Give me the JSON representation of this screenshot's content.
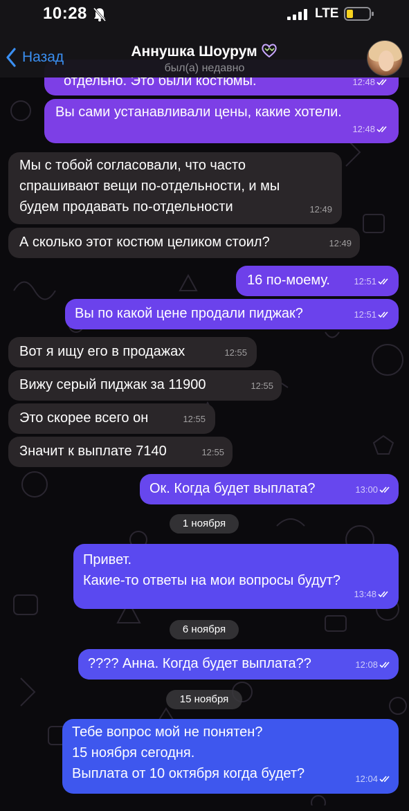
{
  "status_bar": {
    "time": "10:28",
    "network": "LTE"
  },
  "header": {
    "back_label": "Назад",
    "title": "Аннушка Шоурум",
    "status": "был(а) недавно"
  },
  "messages": [
    {
      "id": "m0",
      "direction": "out",
      "text": "отдельно. Это были костюмы.",
      "time": "12:48"
    },
    {
      "id": "m1",
      "direction": "out",
      "text": "Вы сами устанавливали цены, какие хотели.",
      "time": "12:48"
    },
    {
      "id": "m2",
      "direction": "in",
      "text": "Мы с тобой согласовали, что часто\nспрашивают вещи по-отдельности, и мы\nбудем продавать по-отдельности",
      "time": "12:49"
    },
    {
      "id": "m3",
      "direction": "in",
      "text": "А сколько этот костюм целиком стоил?",
      "time": "12:49"
    },
    {
      "id": "m4",
      "direction": "out",
      "text": "16 по-моему.",
      "time": "12:51"
    },
    {
      "id": "m5",
      "direction": "out",
      "text": "Вы по какой цене продали пиджак?",
      "time": "12:51"
    },
    {
      "id": "m6",
      "direction": "in",
      "text": "Вот я ищу его в продажах",
      "time": "12:55"
    },
    {
      "id": "m7",
      "direction": "in",
      "text": "Вижу серый пиджак за 11900",
      "time": "12:55"
    },
    {
      "id": "m8",
      "direction": "in",
      "text": "Это скорее всего он",
      "time": "12:55"
    },
    {
      "id": "m9",
      "direction": "in",
      "text": "Значит к выплате 7140",
      "time": "12:55"
    },
    {
      "id": "m10",
      "direction": "out",
      "text": "Ок. Когда будет выплата?",
      "time": "13:00"
    },
    {
      "id": "m11",
      "direction": "out",
      "text": "Привет.\nКакие-то ответы на мои вопросы будут?",
      "time": "13:48"
    },
    {
      "id": "m12",
      "direction": "out",
      "text": "???? Анна. Когда будет выплата??",
      "time": "12:08"
    },
    {
      "id": "m13",
      "direction": "out",
      "text": "Тебе вопрос мой не понятен?\n15 ноября сегодня.\nВыплата от 10 октября когда будет?",
      "time": "12:04"
    }
  ],
  "dates": {
    "d1": "1 ноября",
    "d2": "6 ноября",
    "d3": "15 ноября"
  },
  "colors": {
    "outgoing_bubble_top": "#7d3fe6",
    "outgoing_bubble_bottom": "#3e57ee",
    "incoming_bubble": "#2a2629",
    "accent": "#3a8ff2"
  },
  "icons": [
    "bell-slash-icon",
    "signal-icon",
    "battery-icon",
    "chevron-left-icon",
    "heart-icon",
    "double-check-icon"
  ]
}
